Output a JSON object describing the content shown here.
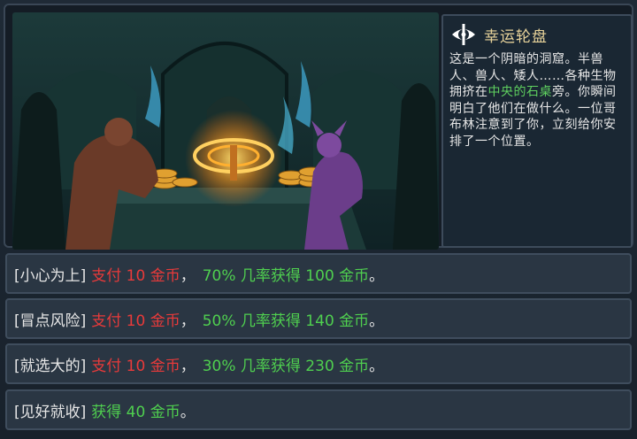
{
  "event": {
    "title": "幸运轮盘",
    "icon": "eye-icon",
    "description_parts": [
      {
        "text": "这是一个阴暗的洞窟。半兽人、兽人、矮人……各种生物拥挤在",
        "highlight": false
      },
      {
        "text": "中央的石桌",
        "highlight": true
      },
      {
        "text": "旁。你瞬间明白了他们在做什么。一位哥布林注意到了你，立刻给你安排了一个位置。",
        "highlight": false
      }
    ]
  },
  "choices": [
    {
      "tag": "[小心为上]",
      "cost": "支付 10 金币",
      "sep": "，",
      "gain": "70% 几率获得 100 金币",
      "end": "。"
    },
    {
      "tag": "[冒点风险]",
      "cost": "支付 10 金币",
      "sep": "，",
      "gain": "50% 几率获得 140 金币",
      "end": "。"
    },
    {
      "tag": "[就选大的]",
      "cost": "支付 10 金币",
      "sep": "，",
      "gain": "30% 几率获得 230 金币",
      "end": "。"
    },
    {
      "tag": "[见好就收]",
      "cost": "",
      "sep": "",
      "gain": "获得 40 金币",
      "end": "。"
    }
  ],
  "colors": {
    "cost": "#e83a3a",
    "gain": "#4fcf4f",
    "title": "#e8d39a",
    "highlight": "#5fd05f"
  }
}
